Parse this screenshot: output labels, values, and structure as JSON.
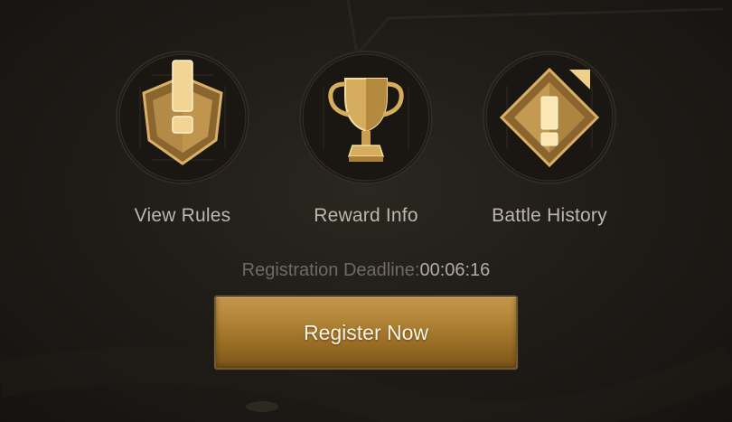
{
  "menu": {
    "items": [
      {
        "label": "View Rules",
        "icon": "alert-pentagon-icon"
      },
      {
        "label": "Reward Info",
        "icon": "trophy-icon"
      },
      {
        "label": "Battle History",
        "icon": "alert-diamond-icon"
      }
    ]
  },
  "registration": {
    "deadline_label": "Registration Deadline:",
    "countdown": "00:06:16",
    "button_label": "Register Now"
  },
  "colors": {
    "gold": "#d9b064",
    "label_text": "#bdb6aa",
    "deadline_text": "#6f6a61",
    "button_gold": "#b48638"
  }
}
